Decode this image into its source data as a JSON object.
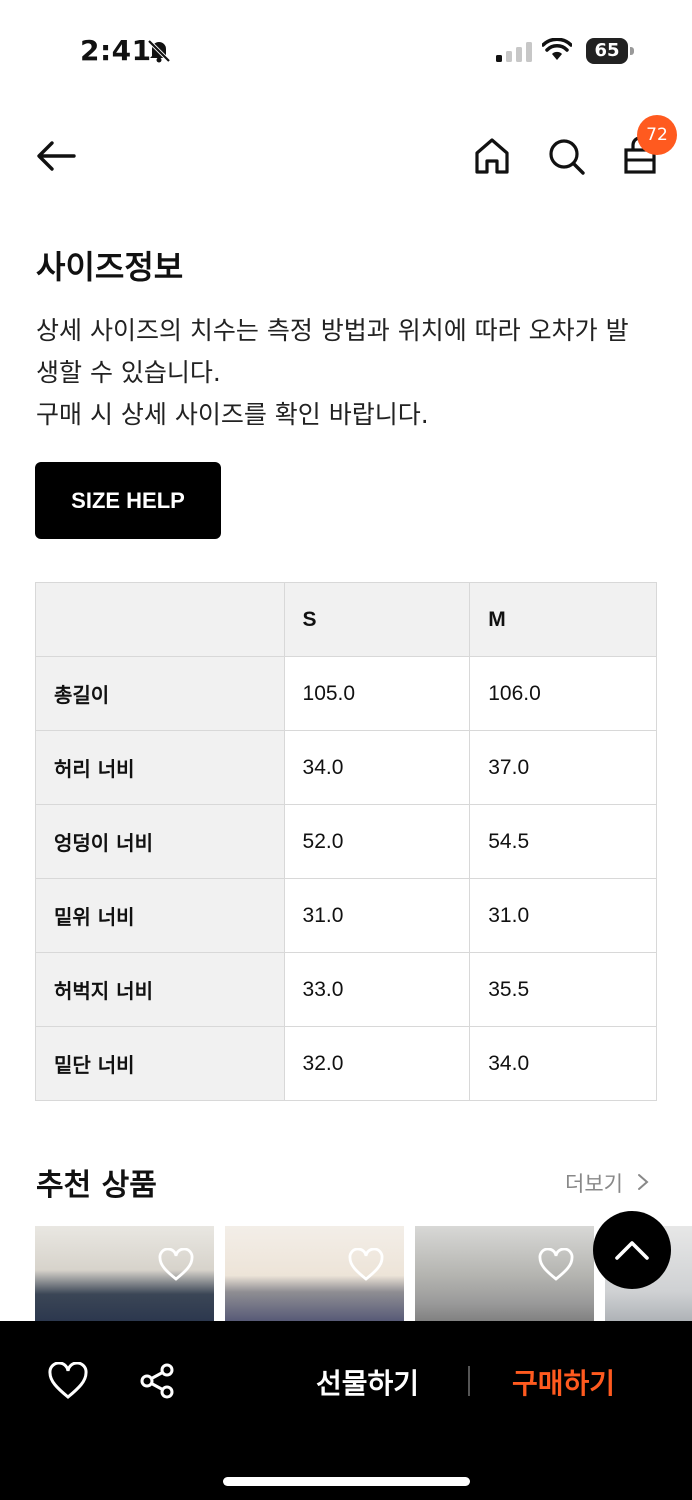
{
  "status_bar": {
    "time": "2:41",
    "battery": "65"
  },
  "header": {
    "cart_count": "72"
  },
  "size_info": {
    "title": "사이즈정보",
    "description": [
      "상세 사이즈의 치수는 측정 방법과 위치에 따라 오차가 발",
      "생할 수 있습니다.",
      "구매 시 상세 사이즈를 확인 바랍니다."
    ],
    "help_button": "SIZE HELP"
  },
  "size_table": {
    "headers": [
      "",
      "S",
      "M"
    ],
    "rows": [
      {
        "label": "총길이",
        "values": [
          "105.0",
          "106.0"
        ]
      },
      {
        "label": "허리 너비",
        "values": [
          "34.0",
          "37.0"
        ]
      },
      {
        "label": "엉덩이 너비",
        "values": [
          "52.0",
          "54.5"
        ]
      },
      {
        "label": "밑위 너비",
        "values": [
          "31.0",
          "31.0"
        ]
      },
      {
        "label": "허벅지 너비",
        "values": [
          "33.0",
          "35.5"
        ]
      },
      {
        "label": "밑단 너비",
        "values": [
          "32.0",
          "34.0"
        ]
      }
    ]
  },
  "recommended": {
    "title": "추천 상품",
    "more_label": "더보기"
  },
  "bottom_bar": {
    "gift_label": "선물하기",
    "buy_label": "구매하기"
  },
  "colors": {
    "accent": "#ff5a1f",
    "button_bg": "#000000",
    "table_header_bg": "#f1f1f1"
  }
}
